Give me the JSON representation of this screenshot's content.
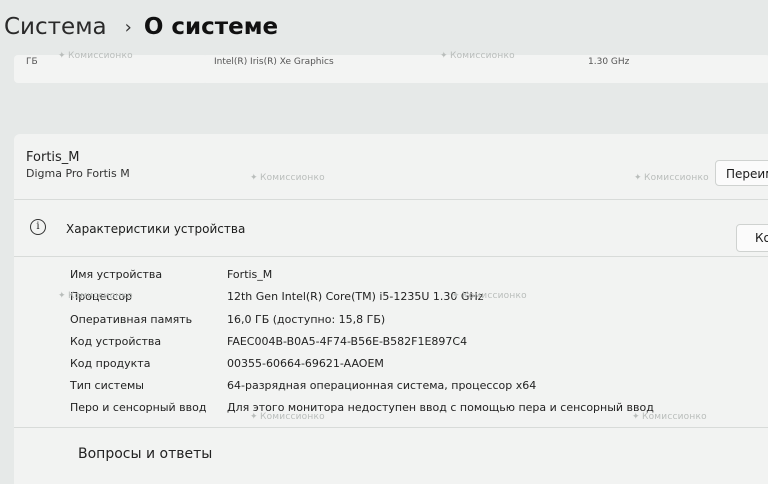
{
  "breadcrumb": {
    "parent": "Система",
    "separator": "›",
    "current": "О системе"
  },
  "top_cards": [
    {
      "text": "ГБ"
    },
    {
      "text": "Intel(R) Iris(R) Xe Graphics"
    },
    {
      "text": ""
    },
    {
      "text": "1.30 GHz"
    }
  ],
  "device": {
    "name": "Fortis_M",
    "model": "Digma Pro Fortis M",
    "rename_label": "Переим"
  },
  "specs": {
    "title": "Характеристики устройства",
    "copy_label": "Ко",
    "rows": [
      {
        "label": "Имя устройства",
        "value": "Fortis_M"
      },
      {
        "label": "Процессор",
        "value": "12th Gen Intel(R) Core(TM) i5-1235U   1.30 GHz"
      },
      {
        "label": "Оперативная память",
        "value": "16,0 ГБ (доступно: 15,8 ГБ)"
      },
      {
        "label": "Код устройства",
        "value": "FAEC004B-B0A5-4F74-B56E-B582F1E897C4"
      },
      {
        "label": "Код продукта",
        "value": "00355-60664-69621-AAOEM"
      },
      {
        "label": "Тип системы",
        "value": "64-разрядная операционная система, процессор x64"
      },
      {
        "label": "Перо и сенсорный ввод",
        "value": "Для этого монитора недоступен ввод с помощью пера и сенсорный ввод"
      }
    ]
  },
  "faq": {
    "title": "Вопросы и ответы"
  },
  "watermark_text": "Комиссионко"
}
